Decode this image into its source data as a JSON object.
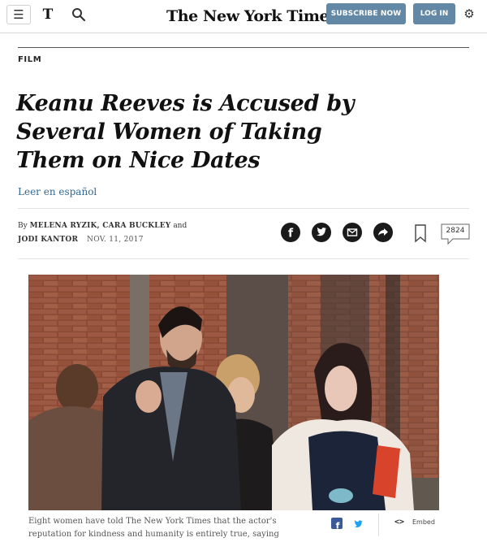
{
  "header": {
    "masthead": "The New York Times",
    "subscribe_label": "SUBSCRIBE NOW",
    "login_label": "LOG IN",
    "sections_icon": "hamburger-menu-icon",
    "sections_glyph": "T"
  },
  "article": {
    "kicker": "FILM",
    "headline": "Keanu Reeves is Accused by Several Women of Taking Them on Nice Dates",
    "spanish_link": "Leer en español",
    "byline": {
      "prefix": "By",
      "authors_line1": "MELENA RYZIK, CARA BUCKLEY",
      "and": "and",
      "authors_line2": "JODI KANTOR",
      "date": "NOV. 11, 2017"
    },
    "share_icons": [
      "facebook-icon",
      "twitter-icon",
      "email-icon",
      "share-arrow-icon",
      "bookmark-icon"
    ],
    "comment_count": "2824"
  },
  "photo": {
    "caption": "Eight women have told The New York Times that the actor's reputation for kindness and humanity is entirely true, saying",
    "embed_label": "Embed"
  },
  "colors": {
    "button_blue": "#6288a5",
    "link_blue": "#326891",
    "facebook_blue": "#3b5998",
    "twitter_blue": "#1da1f2"
  }
}
